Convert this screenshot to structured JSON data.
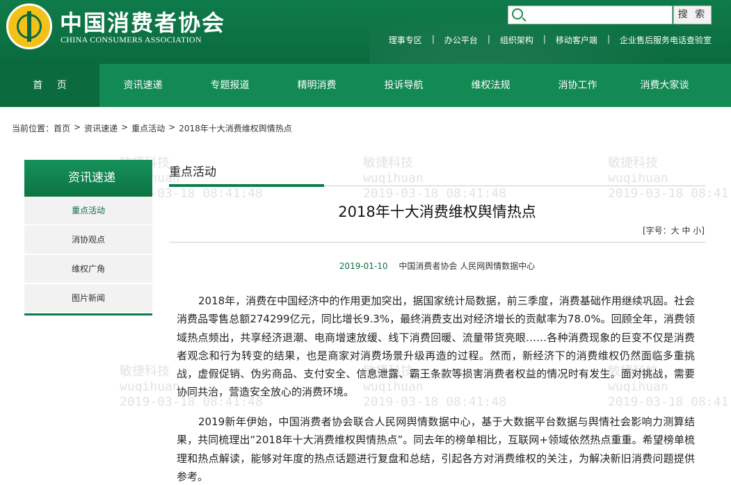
{
  "header": {
    "site_name": "中国消费者协会",
    "site_name_en": "CHINA CONSUMERS ASSOCIATION",
    "search_placeholder": "",
    "search_button": "搜 索",
    "top_links": [
      "理事专区",
      "办公平台",
      "组织架构",
      "移动客户端",
      "企业售后服务电话查验室"
    ]
  },
  "nav": [
    "首 页",
    "资讯速递",
    "专题报道",
    "精明消费",
    "投诉导航",
    "维权法规",
    "消协工作",
    "消费大家谈"
  ],
  "breadcrumb": {
    "label": "当前位置：",
    "items": [
      "首页",
      "资讯速递",
      "重点活动",
      "2018年十大消费维权舆情热点"
    ],
    "separator": ">"
  },
  "sidebar": {
    "title": "资讯速递",
    "items": [
      "重点活动",
      "消协观点",
      "维权广角",
      "图片新闻"
    ]
  },
  "content": {
    "section_title": "重点活动",
    "article_title": "2018年十大消费维权舆情热点",
    "font_size_control": "[字号：大 中 小]",
    "date": "2019-01-10",
    "source": "中国消费者协会 人民网舆情数据中心",
    "paragraphs": [
      "2018年，消费在中国经济中的作用更加突出，据国家统计局数据，前三季度，消费基础作用继续巩固。社会消费品零售总额274299亿元，同比增长9.3%，最终消费支出对经济增长的贡献率为78.0%。回顾全年，消费领域热点频出，共享经济退潮、电商增速放缓、线下消费回暖、流量带货亮眼……各种消费现象的巨变不仅是消费者观念和行为转变的结果，也是商家对消费场景升级再造的过程。然而，新经济下的消费维权仍然面临多重挑战，虚假促销、伪劣商品、支付安全、信息泄露、霸王条款等损害消费者权益的情况时有发生。面对挑战，需要协同共治，营造安全放心的消费环境。",
      "2019新年伊始，中国消费者协会联合人民网舆情数据中心，基于大数据平台数据与舆情社会影响力测算结果，共同梳理出“2018年十大消费维权舆情热点”。同去年的榜单相比，互联网+领域依然热点重重。希望榜单梳理和热点解读，能够对年度的热点话题进行复盘和总结，引起各方对消费维权的关注，为解决新旧消费问题提供参考。"
    ]
  },
  "watermark": {
    "company": "敏捷科技",
    "user": "wuqihuan",
    "time": "2019-03-18 08:41:48"
  },
  "colors": {
    "brand_green": "#0d7c48",
    "nav_green": "#138a54",
    "nav_active": "#0b6a3e"
  }
}
